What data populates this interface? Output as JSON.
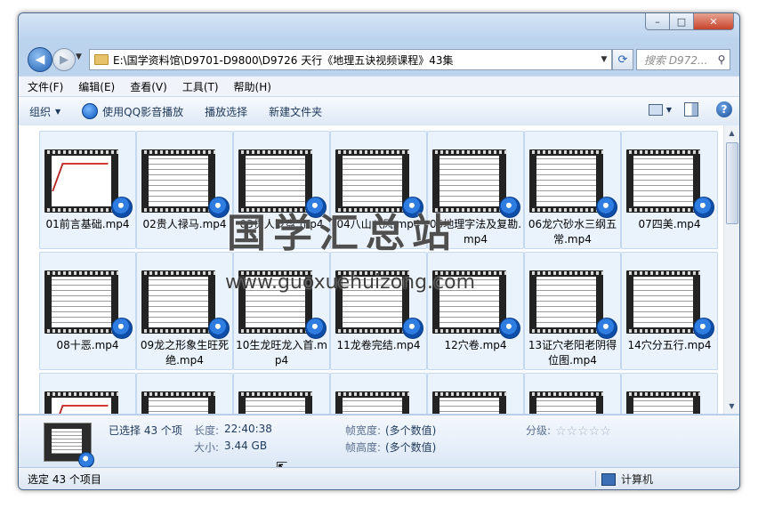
{
  "window": {
    "minimize_glyph": "–",
    "maximize_glyph": "□",
    "close_glyph": "✕"
  },
  "nav": {
    "back_glyph": "◀",
    "forward_glyph": "▶",
    "history_glyph": "▼",
    "address": "E:\\国学资料馆\\D9701-D9800\\D9726 天行《地理五诀视频课程》43集",
    "dropdown_glyph": "▼",
    "refresh_glyph": "⟳",
    "search_placeholder": "搜索 D972...",
    "search_glyph": "⚲"
  },
  "menu": [
    "文件(F)",
    "编辑(E)",
    "查看(V)",
    "工具(T)",
    "帮助(H)"
  ],
  "toolbar": {
    "organize": "组织",
    "play_qq": "使用QQ影音播放",
    "play_selection": "播放选择",
    "new_folder": "新建文件夹",
    "arrow": "▼",
    "help_glyph": "?"
  },
  "files": [
    {
      "name": "01前言基础.mp4",
      "thumb": "hand"
    },
    {
      "name": "02贵人禄马.mp4",
      "thumb": "text"
    },
    {
      "name": "03贵人罗盘.mp4",
      "thumb": "text"
    },
    {
      "name": "04八山八风.mp4",
      "thumb": "text"
    },
    {
      "name": "05地理字法及复勘.mp4",
      "thumb": "text"
    },
    {
      "name": "06龙穴砂水三纲五常.mp4",
      "thumb": "text"
    },
    {
      "name": "07四美.mp4",
      "thumb": "text"
    },
    {
      "name": "08十恶.mp4",
      "thumb": "text"
    },
    {
      "name": "09龙之形象生旺死绝.mp4",
      "thumb": "text"
    },
    {
      "name": "10生龙旺龙入首.mp4",
      "thumb": "text"
    },
    {
      "name": "11龙卷完结.mp4",
      "thumb": "text"
    },
    {
      "name": "12穴卷.mp4",
      "thumb": "text"
    },
    {
      "name": "13证穴老阳老阴得位图.mp4",
      "thumb": "text"
    },
    {
      "name": "14穴分五行.mp4",
      "thumb": "text"
    },
    {
      "name": "",
      "thumb": "hand"
    },
    {
      "name": "",
      "thumb": "text"
    },
    {
      "name": "",
      "thumb": "text"
    },
    {
      "name": "",
      "thumb": "text"
    },
    {
      "name": "",
      "thumb": "text"
    },
    {
      "name": "",
      "thumb": "text"
    },
    {
      "name": "",
      "thumb": "text"
    }
  ],
  "scroll": {
    "up": "▲",
    "down": "▼"
  },
  "details": {
    "selected": "已选择 43 个项",
    "length_label": "长度:",
    "length_value": "22:40:38",
    "size_label": "大小:",
    "size_value": "3.44 GB",
    "frame_width_label": "帧宽度:",
    "frame_width_value": "(多个数值)",
    "frame_height_label": "帧高度:",
    "frame_height_value": "(多个数值)",
    "rating_label": "分级:",
    "rating_stars": "☆☆☆☆☆",
    "cursor_glyph": "⇱"
  },
  "status": {
    "left": "选定 43 个项目",
    "right": "计算机"
  },
  "watermark": {
    "title": "国学汇总站",
    "url": "www.guoxuehuizong.com"
  }
}
